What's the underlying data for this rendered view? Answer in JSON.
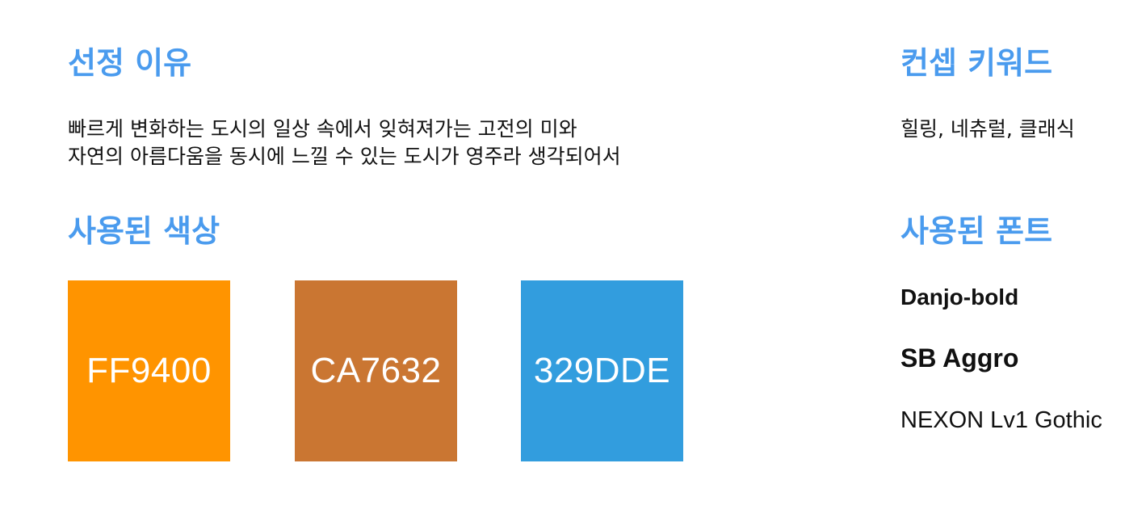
{
  "sections": {
    "reason_title": "선정 이유",
    "concept_title": "컨셉 키워드",
    "colors_title": "사용된 색상",
    "fonts_title": "사용된 폰트"
  },
  "reason": {
    "line1": "빠르게 변화하는 도시의 일상 속에서 잊혀져가는 고전의 미와",
    "line2": "자연의 아름다움을 동시에 느낄 수 있는 도시가 영주라 생각되어서"
  },
  "concept": {
    "keywords": "힐링, 네츄럴, 클래식"
  },
  "colors": [
    {
      "label": "FF9400",
      "hex": "#FF9400"
    },
    {
      "label": "CA7632",
      "hex": "#CA7632"
    },
    {
      "label": "329DDE",
      "hex": "#329DDE"
    }
  ],
  "fonts": [
    {
      "name": "Danjo-bold"
    },
    {
      "name": "SB Aggro"
    },
    {
      "name": "NEXON Lv1 Gothic"
    }
  ],
  "accent_color": "#4A9BEE"
}
